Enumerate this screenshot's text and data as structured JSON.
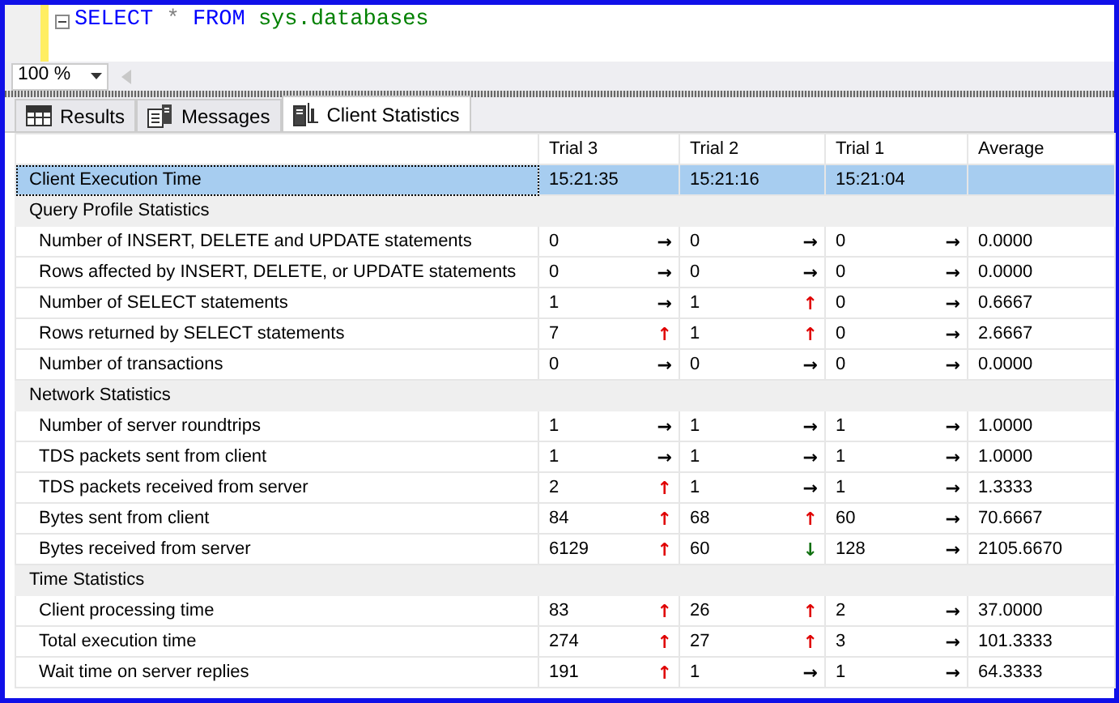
{
  "editor": {
    "query": "SELECT * FROM sys.databases",
    "zoom": "100 %"
  },
  "tabs": [
    {
      "label": "Results",
      "kind": "grid",
      "selected": false
    },
    {
      "label": "Messages",
      "kind": "messages",
      "selected": false
    },
    {
      "label": "Client Statistics",
      "kind": "stats",
      "selected": true
    }
  ],
  "table": {
    "columns": [
      "Trial  3",
      "Trial  2",
      "Trial  1",
      "Average"
    ],
    "rows": [
      {
        "kind": "time",
        "label": "Client Execution Time",
        "selected": true,
        "values": [
          {
            "value": "15:21:35"
          },
          {
            "value": "15:21:16"
          },
          {
            "value": "15:21:04"
          }
        ]
      },
      {
        "kind": "group",
        "label": "Query Profile Statistics"
      },
      {
        "kind": "stat",
        "label": "Number of INSERT, DELETE and UPDATE statements",
        "values": [
          {
            "value": "0",
            "arrow": "→",
            "color": "#000000"
          },
          {
            "value": "0",
            "arrow": "→",
            "color": "#000000"
          },
          {
            "value": "0",
            "arrow": "→",
            "color": "#000000"
          },
          {
            "value": "0.0000"
          }
        ]
      },
      {
        "kind": "stat",
        "label": "Rows affected by INSERT, DELETE, or UPDATE statements",
        "values": [
          {
            "value": "0",
            "arrow": "→",
            "color": "#000000"
          },
          {
            "value": "0",
            "arrow": "→",
            "color": "#000000"
          },
          {
            "value": "0",
            "arrow": "→",
            "color": "#000000"
          },
          {
            "value": "0.0000"
          }
        ]
      },
      {
        "kind": "stat",
        "label": "Number of SELECT statements",
        "values": [
          {
            "value": "1",
            "arrow": "→",
            "color": "#000000"
          },
          {
            "value": "1",
            "arrow": "↑",
            "color": "#e00000"
          },
          {
            "value": "0",
            "arrow": "→",
            "color": "#000000"
          },
          {
            "value": "0.6667"
          }
        ]
      },
      {
        "kind": "stat",
        "label": "Rows returned by SELECT statements",
        "values": [
          {
            "value": "7",
            "arrow": "↑",
            "color": "#e00000"
          },
          {
            "value": "1",
            "arrow": "↑",
            "color": "#e00000"
          },
          {
            "value": "0",
            "arrow": "→",
            "color": "#000000"
          },
          {
            "value": "2.6667"
          }
        ]
      },
      {
        "kind": "stat",
        "label": "Number of transactions",
        "values": [
          {
            "value": "0",
            "arrow": "→",
            "color": "#000000"
          },
          {
            "value": "0",
            "arrow": "→",
            "color": "#000000"
          },
          {
            "value": "0",
            "arrow": "→",
            "color": "#000000"
          },
          {
            "value": "0.0000"
          }
        ]
      },
      {
        "kind": "group",
        "label": "Network Statistics"
      },
      {
        "kind": "stat",
        "label": "Number of server roundtrips",
        "values": [
          {
            "value": "1",
            "arrow": "→",
            "color": "#000000"
          },
          {
            "value": "1",
            "arrow": "→",
            "color": "#000000"
          },
          {
            "value": "1",
            "arrow": "→",
            "color": "#000000"
          },
          {
            "value": "1.0000"
          }
        ]
      },
      {
        "kind": "stat",
        "label": "TDS packets sent from client",
        "values": [
          {
            "value": "1",
            "arrow": "→",
            "color": "#000000"
          },
          {
            "value": "1",
            "arrow": "→",
            "color": "#000000"
          },
          {
            "value": "1",
            "arrow": "→",
            "color": "#000000"
          },
          {
            "value": "1.0000"
          }
        ]
      },
      {
        "kind": "stat",
        "label": "TDS packets received from server",
        "values": [
          {
            "value": "2",
            "arrow": "↑",
            "color": "#e00000"
          },
          {
            "value": "1",
            "arrow": "→",
            "color": "#000000"
          },
          {
            "value": "1",
            "arrow": "→",
            "color": "#000000"
          },
          {
            "value": "1.3333"
          }
        ]
      },
      {
        "kind": "stat",
        "label": "Bytes sent from client",
        "values": [
          {
            "value": "84",
            "arrow": "↑",
            "color": "#e00000"
          },
          {
            "value": "68",
            "arrow": "↑",
            "color": "#e00000"
          },
          {
            "value": "60",
            "arrow": "→",
            "color": "#000000"
          },
          {
            "value": "70.6667"
          }
        ]
      },
      {
        "kind": "stat",
        "label": "Bytes received from server",
        "values": [
          {
            "value": "6129",
            "arrow": "↑",
            "color": "#e00000"
          },
          {
            "value": "60",
            "arrow": "↓",
            "color": "#107010"
          },
          {
            "value": "128",
            "arrow": "→",
            "color": "#000000"
          },
          {
            "value": "2105.6670"
          }
        ]
      },
      {
        "kind": "group",
        "label": "Time Statistics"
      },
      {
        "kind": "stat",
        "label": "Client processing time",
        "values": [
          {
            "value": "83",
            "arrow": "↑",
            "color": "#e00000"
          },
          {
            "value": "26",
            "arrow": "↑",
            "color": "#e00000"
          },
          {
            "value": "2",
            "arrow": "→",
            "color": "#000000"
          },
          {
            "value": "37.0000"
          }
        ]
      },
      {
        "kind": "stat",
        "label": "Total execution time",
        "values": [
          {
            "value": "274",
            "arrow": "↑",
            "color": "#e00000"
          },
          {
            "value": "27",
            "arrow": "↑",
            "color": "#e00000"
          },
          {
            "value": "3",
            "arrow": "→",
            "color": "#000000"
          },
          {
            "value": "101.3333"
          }
        ]
      },
      {
        "kind": "stat",
        "label": "Wait time on server replies",
        "values": [
          {
            "value": "191",
            "arrow": "↑",
            "color": "#e00000"
          },
          {
            "value": "1",
            "arrow": "→",
            "color": "#000000"
          },
          {
            "value": "1",
            "arrow": "→",
            "color": "#000000"
          },
          {
            "value": "64.3333"
          }
        ]
      }
    ]
  }
}
